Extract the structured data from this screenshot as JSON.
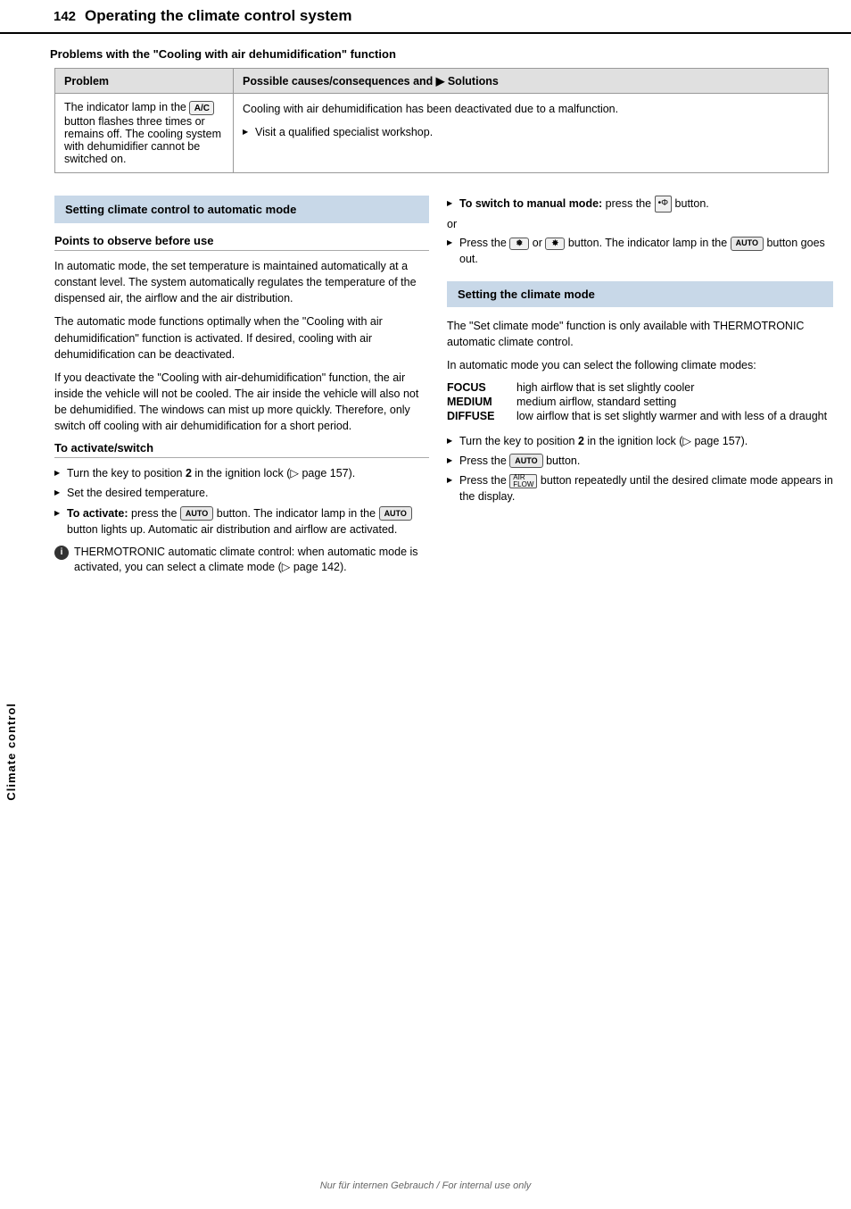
{
  "header": {
    "page_number": "142",
    "title": "Operating the climate control system"
  },
  "problems_section": {
    "heading": "Problems with the \"Cooling with air dehumidification\" function",
    "table": {
      "col1_header": "Problem",
      "col2_header": "Possible causes/consequences and ▶ Solutions",
      "rows": [
        {
          "problem": "The indicator lamp in the  A/C  button flashes three times or remains off. The cooling system with dehumidifier cannot be switched on.",
          "solutions": [
            "Cooling with air dehumidification has been deactivated due to a malfunction.",
            "Visit a qualified specialist workshop."
          ]
        }
      ]
    }
  },
  "left_column": {
    "main_heading": "Setting climate control to automatic mode",
    "subheading1": "Points to observe before use",
    "para1": "In automatic mode, the set temperature is maintained automatically at a constant level. The system automatically regulates the temperature of the dispensed air, the airflow and the air distribution.",
    "para2": "The automatic mode functions optimally when the \"Cooling with air dehumidification\" function is activated. If desired, cooling with air dehumidification can be deactivated.",
    "para3": "If you deactivate the \"Cooling with air-dehumidification\" function, the air inside the vehicle will not be cooled. The air inside the vehicle will also not be dehumidified. The windows can mist up more quickly. Therefore, only switch off cooling with air dehumidification for a short period.",
    "subheading2": "To activate/switch",
    "activate_bullets": [
      "Turn the key to position 2 in the ignition lock (▷ page 157).",
      "Set the desired temperature.",
      "To activate: press the  AUTO  button. The indicator lamp in the  AUTO  button lights up. Automatic air distribution and airflow are activated.",
      "THERMOTRONIC automatic climate control: when automatic mode is activated, you can select a climate mode (▷ page 142)."
    ]
  },
  "right_column": {
    "manual_mode_bullets": [
      "To switch to manual mode: press the  manual  button.",
      "Press the  snow  or  fan  button. The indicator lamp in the  AUTO  button goes out."
    ],
    "or_text": "or",
    "setting_climate_heading": "Setting the climate mode",
    "para1": "The \"Set climate mode\" function is only available with THERMOTRONIC automatic climate control.",
    "para2": "In automatic mode you can select the following climate modes:",
    "modes": [
      {
        "label": "FOCUS",
        "desc": "high airflow that is set slightly cooler"
      },
      {
        "label": "MEDIUM",
        "desc": "medium airflow, standard setting"
      },
      {
        "label": "DIFFUSE",
        "desc": "low airflow that is set slightly warmer and with less of a draught"
      }
    ],
    "climate_bullets": [
      "Turn the key to position 2 in the ignition lock (▷ page 157).",
      "Press the  AUTO  button.",
      "Press the  AIR FLOW  button repeatedly until the desired climate mode appears in the display."
    ]
  },
  "footer": {
    "text": "Nur für internen Gebrauch / For internal use only"
  },
  "side_label": "Climate control"
}
